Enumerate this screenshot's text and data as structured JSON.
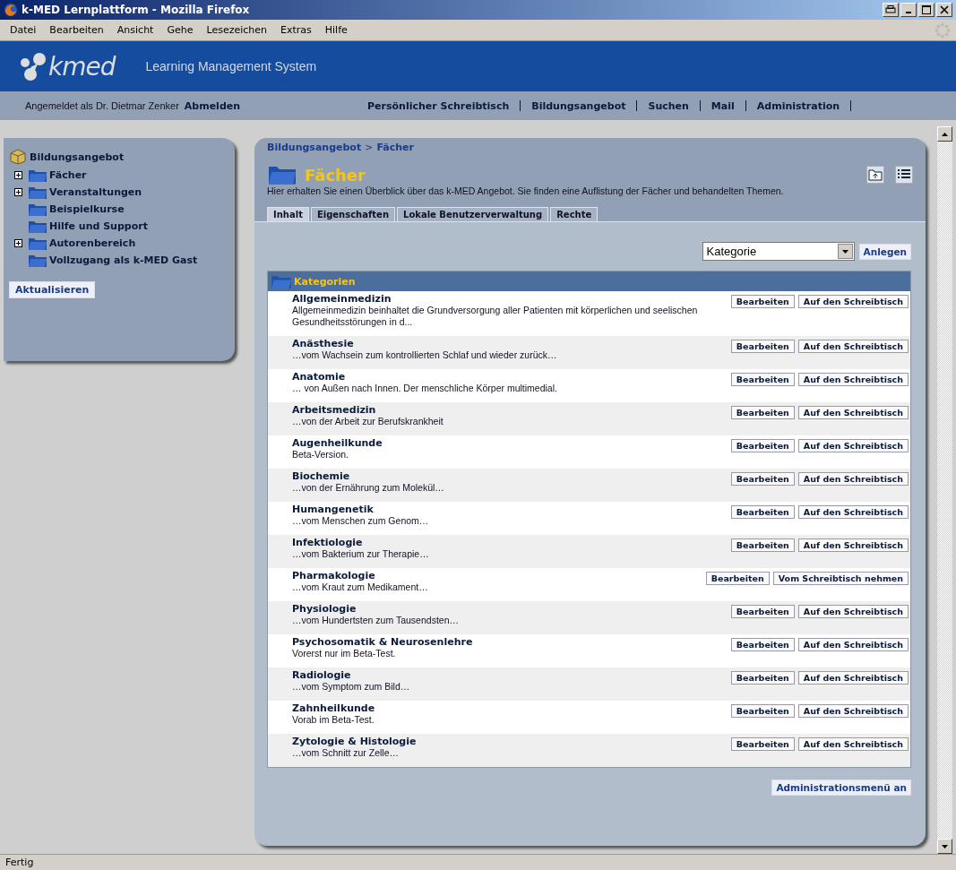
{
  "window": {
    "title": "k-MED Lernplattform - Mozilla Firefox"
  },
  "menu": [
    "Datei",
    "Bearbeiten",
    "Ansicht",
    "Gehe",
    "Lesezeichen",
    "Extras",
    "Hilfe"
  ],
  "banner": {
    "logo": "kmed",
    "subtitle": "Learning Management System"
  },
  "userbar": {
    "login": "Angemeldet als Dr. Dietmar Zenker",
    "logout": "Abmelden",
    "nav": [
      "Persönlicher Schreibtisch",
      "Bildungsangebot",
      "Suchen",
      "Mail",
      "Administration"
    ]
  },
  "sidebar": {
    "root": "Bildungsangebot",
    "items": [
      {
        "label": "Fächer",
        "expandable": true
      },
      {
        "label": "Veranstaltungen",
        "expandable": true
      },
      {
        "label": "Beispielkurse",
        "expandable": false
      },
      {
        "label": "Hilfe und Support",
        "expandable": false
      },
      {
        "label": "Autorenbereich",
        "expandable": true
      },
      {
        "label": "Vollzugang als k-MED Gast",
        "expandable": false
      }
    ],
    "refresh": "Aktualisieren"
  },
  "main": {
    "breadcrumb": [
      "Bildungsangebot",
      "Fächer"
    ],
    "separator": ">",
    "title": "Fächer",
    "description": "Hier erhalten Sie einen Überblick über das k-MED Angebot. Sie finden eine Auflistung der Fächer und behandelten Themen.",
    "tabs": [
      {
        "label": "Inhalt",
        "selected": true
      },
      {
        "label": "Eigenschaften",
        "selected": false
      },
      {
        "label": "Lokale Benutzerverwaltung",
        "selected": false
      },
      {
        "label": "Rechte",
        "selected": false
      }
    ],
    "type_select": {
      "value": "Kategorie"
    },
    "create_button": "Anlegen",
    "list": {
      "header": "Kategorien",
      "rows": [
        {
          "title": "Allgemeinmedizin",
          "text": "Allgemeinmedizin beinhaltet die Grundversorgung aller Patienten mit körperlichen und seelischen Gesundheitsstörungen in d...",
          "edit": "Bearbeiten",
          "desk": "Auf den Schreibtisch"
        },
        {
          "title": "Anästhesie",
          "text": "…vom Wachsein zum kontrollierten Schlaf und wieder zurück…",
          "edit": "Bearbeiten",
          "desk": "Auf den Schreibtisch"
        },
        {
          "title": "Anatomie",
          "text": "… von Außen nach Innen. Der menschliche Körper multimedial.",
          "edit": "Bearbeiten",
          "desk": "Auf den Schreibtisch"
        },
        {
          "title": "Arbeitsmedizin",
          "text": "…von der Arbeit zur Berufskrankheit",
          "edit": "Bearbeiten",
          "desk": "Auf den Schreibtisch"
        },
        {
          "title": "Augenheilkunde",
          "text": "Beta-Version.",
          "edit": "Bearbeiten",
          "desk": "Auf den Schreibtisch"
        },
        {
          "title": "Biochemie",
          "text": "…von der Ernährung zum Molekül…",
          "edit": "Bearbeiten",
          "desk": "Auf den Schreibtisch"
        },
        {
          "title": "Humangenetik",
          "text": "…vom Menschen zum Genom…",
          "edit": "Bearbeiten",
          "desk": "Auf den Schreibtisch"
        },
        {
          "title": "Infektiologie",
          "text": "…vom Bakterium zur Therapie…",
          "edit": "Bearbeiten",
          "desk": "Auf den Schreibtisch"
        },
        {
          "title": "Pharmakologie",
          "text": "…vom Kraut zum Medikament…",
          "edit": "Bearbeiten",
          "desk": "Vom Schreibtisch nehmen"
        },
        {
          "title": "Physiologie",
          "text": "…vom Hundertsten zum Tausendsten…",
          "edit": "Bearbeiten",
          "desk": "Auf den Schreibtisch"
        },
        {
          "title": "Psychosomatik & Neurosenlehre",
          "text": "Vorerst nur im Beta-Test.",
          "edit": "Bearbeiten",
          "desk": "Auf den Schreibtisch"
        },
        {
          "title": "Radiologie",
          "text": "…vom Symptom zum Bild…",
          "edit": "Bearbeiten",
          "desk": "Auf den Schreibtisch"
        },
        {
          "title": "Zahnheilkunde",
          "text": "Vorab im Beta-Test.",
          "edit": "Bearbeiten",
          "desk": "Auf den Schreibtisch"
        },
        {
          "title": "Zytologie & Histologie",
          "text": "…vom Schnitt zur Zelle…",
          "edit": "Bearbeiten",
          "desk": "Auf den Schreibtisch"
        }
      ]
    },
    "admin_button": "Administrationsmenü an"
  },
  "status_bar": {
    "text": "Fertig"
  }
}
